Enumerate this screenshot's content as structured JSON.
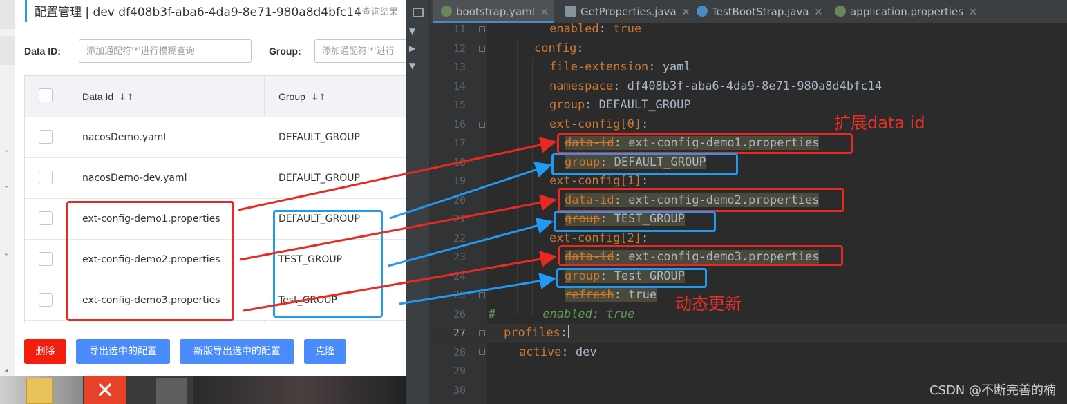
{
  "console": {
    "title": "配置管理  |  dev  df408b3f-aba6-4da9-8e71-980a8d4bfc14",
    "hint": "查询结果",
    "filters": {
      "data_id_label": "Data ID:",
      "data_id_placeholder": "添加通配符'*'进行模糊查询",
      "group_label": "Group:",
      "group_placeholder": "添加通配符'*'进行"
    },
    "table": {
      "headers": {
        "data_id": "Data Id",
        "group": "Group"
      },
      "rows": [
        {
          "data_id": "nacosDemo.yaml",
          "group": "DEFAULT_GROUP"
        },
        {
          "data_id": "nacosDemo-dev.yaml",
          "group": "DEFAULT_GROUP"
        },
        {
          "data_id": "ext-config-demo1.properties",
          "group": "DEFAULT_GROUP"
        },
        {
          "data_id": "ext-config-demo2.properties",
          "group": "TEST_GROUP"
        },
        {
          "data_id": "ext-config-demo3.properties",
          "group": "Test_GROUP"
        }
      ]
    },
    "buttons": {
      "delete": "删除",
      "export": "导出选中的配置",
      "new_export": "新版导出选中的配置",
      "clone": "克隆"
    }
  },
  "ide": {
    "tabs": [
      {
        "label": "bootstrap.yaml",
        "icon_color": "#6a8759"
      },
      {
        "label": "GetProperties.java",
        "icon_color": "#87939a"
      },
      {
        "label": "TestBootStrap.java",
        "icon_color": "#4a88c7"
      },
      {
        "label": "application.properties",
        "icon_color": "#6a8759"
      }
    ],
    "line_numbers": [
      "11",
      "12",
      "13",
      "14",
      "15",
      "16",
      "17",
      "18",
      "19",
      "20",
      "21",
      "22",
      "23",
      "24",
      "25",
      "26",
      "27",
      "28",
      "29",
      "30"
    ],
    "code": {
      "l11": {
        "key": "enabled",
        "sep": ": ",
        "val": "true"
      },
      "l12": {
        "key": "config",
        "sep": ":"
      },
      "l13": {
        "key": "file-extension",
        "sep": ": ",
        "val": "yaml"
      },
      "l14": {
        "key": "namespace",
        "sep": ": ",
        "val": "df408b3f-aba6-4da9-8e71-980a8d4bfc14"
      },
      "l15": {
        "key": "group",
        "sep": ": ",
        "val": "DEFAULT_GROUP"
      },
      "l16": {
        "key": "ext-config[0]",
        "sep": ":"
      },
      "l17": {
        "key": "data-id",
        "sep": ": ",
        "val": "ext-config-demo1.properties"
      },
      "l18": {
        "key": "group",
        "sep": ": ",
        "val": "DEFAULT_GROUP"
      },
      "l19": {
        "key": "ext-config[1]",
        "sep": ":"
      },
      "l20": {
        "key": "data-id",
        "sep": ": ",
        "val": "ext-config-demo2.properties"
      },
      "l21": {
        "key": "group",
        "sep": ": ",
        "val": "TEST_GROUP"
      },
      "l22": {
        "key": "ext-config[2]",
        "sep": ":"
      },
      "l23": {
        "key": "data-id",
        "sep": ": ",
        "val": "ext-config-demo3.properties"
      },
      "l24": {
        "key": "group",
        "sep": ": ",
        "val": "Test_GROUP"
      },
      "l25": {
        "key": "refresh",
        "sep": ": ",
        "val": "true"
      },
      "l26": {
        "hash": "#",
        "text": "enabled: true"
      },
      "l27": {
        "key": "profiles",
        "sep": ":"
      },
      "l28": {
        "key": "active",
        "sep": ": ",
        "val": "dev"
      }
    }
  },
  "annotations": {
    "ext_data_id": "扩展data id",
    "dynamic_refresh": "动态更新",
    "red_color": "#ea2a22",
    "blue_color": "#1f9bf5"
  },
  "watermark": "CSDN @不断完善的楠"
}
